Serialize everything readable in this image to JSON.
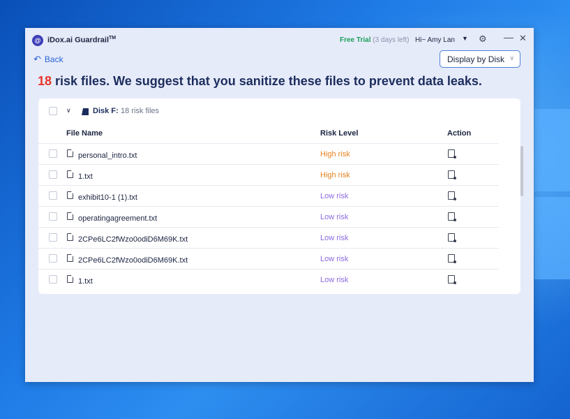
{
  "app": {
    "name": "iDox.ai Guardrail",
    "trademark": "TM",
    "logo_letter": "@",
    "trial_label": "Free Trial",
    "trial_remaining": "(3 days left)",
    "greeting": "Hi~ Amy Lan"
  },
  "icons": {
    "logo": "app-logo-icon",
    "caret": "▼",
    "gear": "⚙",
    "minimize": "—",
    "close": "✕",
    "back_arrow": "↶",
    "chevron": "∨"
  },
  "nav": {
    "back_label": "Back",
    "display_select_value": "Display by Disk"
  },
  "headline": {
    "count": "18",
    "text": " risk files. We suggest that you sanitize these files to prevent data leaks."
  },
  "disk": {
    "label": "Disk F:",
    "count_text": "18 risk files"
  },
  "columns": {
    "file_name": "File Name",
    "risk_level": "Risk Level",
    "action": "Action"
  },
  "files": [
    {
      "name": "personal_intro.txt",
      "risk": "High risk",
      "level": "high"
    },
    {
      "name": "1.txt",
      "risk": "High risk",
      "level": "high"
    },
    {
      "name": "exhibit10-1 (1).txt",
      "risk": "Low risk",
      "level": "low"
    },
    {
      "name": "operatingagreement.txt",
      "risk": "Low risk",
      "level": "low"
    },
    {
      "name": "2CPe6LC2fWzo0odiD6M69K.txt",
      "risk": "Low risk",
      "level": "low"
    },
    {
      "name": "2CPe6LC2fWzo0odiD6M69K.txt",
      "risk": "Low risk",
      "level": "low"
    },
    {
      "name": "1.txt",
      "risk": "Low risk",
      "level": "low"
    }
  ],
  "colors": {
    "accent": "#2a63d6",
    "danger": "#e8352a",
    "high_risk": "#e6821f",
    "low_risk": "#8c6ae0",
    "trial": "#1ca05a"
  }
}
